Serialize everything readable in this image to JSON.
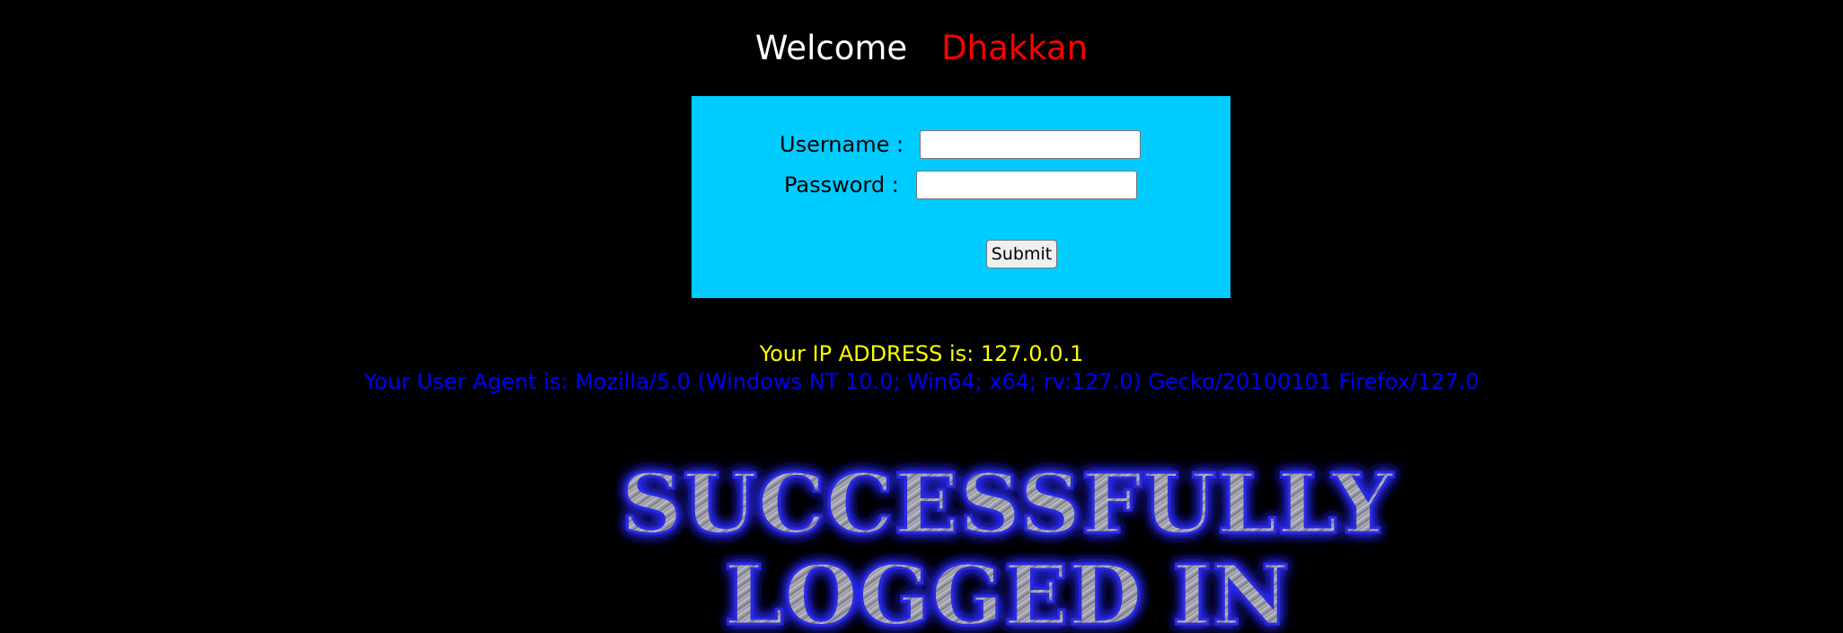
{
  "welcome": {
    "greeting": "Welcome",
    "name": "Dhakkan"
  },
  "login_form": {
    "username_label": "Username :",
    "username_value": "",
    "password_label": "Password :",
    "password_value": "",
    "submit_label": "Submit"
  },
  "info": {
    "ip_text": "Your IP ADDRESS is: 127.0.0.1",
    "user_agent_text": "Your User Agent is: Mozilla/5.0 (Windows NT 10.0; Win64; x64; rv:127.0) Gecko/20100101 Firefox/127.0"
  },
  "banner": {
    "line1": "SUCCESSFULLY",
    "line2": "LOGGED IN",
    "glow_color": "#1a1aff",
    "letter_color": "#a6a6b0"
  },
  "colors": {
    "background": "#000000",
    "form_background": "#00ccff",
    "welcome_text": "#ffffff",
    "name_text": "#ff0000",
    "ip_text": "#ffff00",
    "user_agent_text": "#0000ff"
  }
}
